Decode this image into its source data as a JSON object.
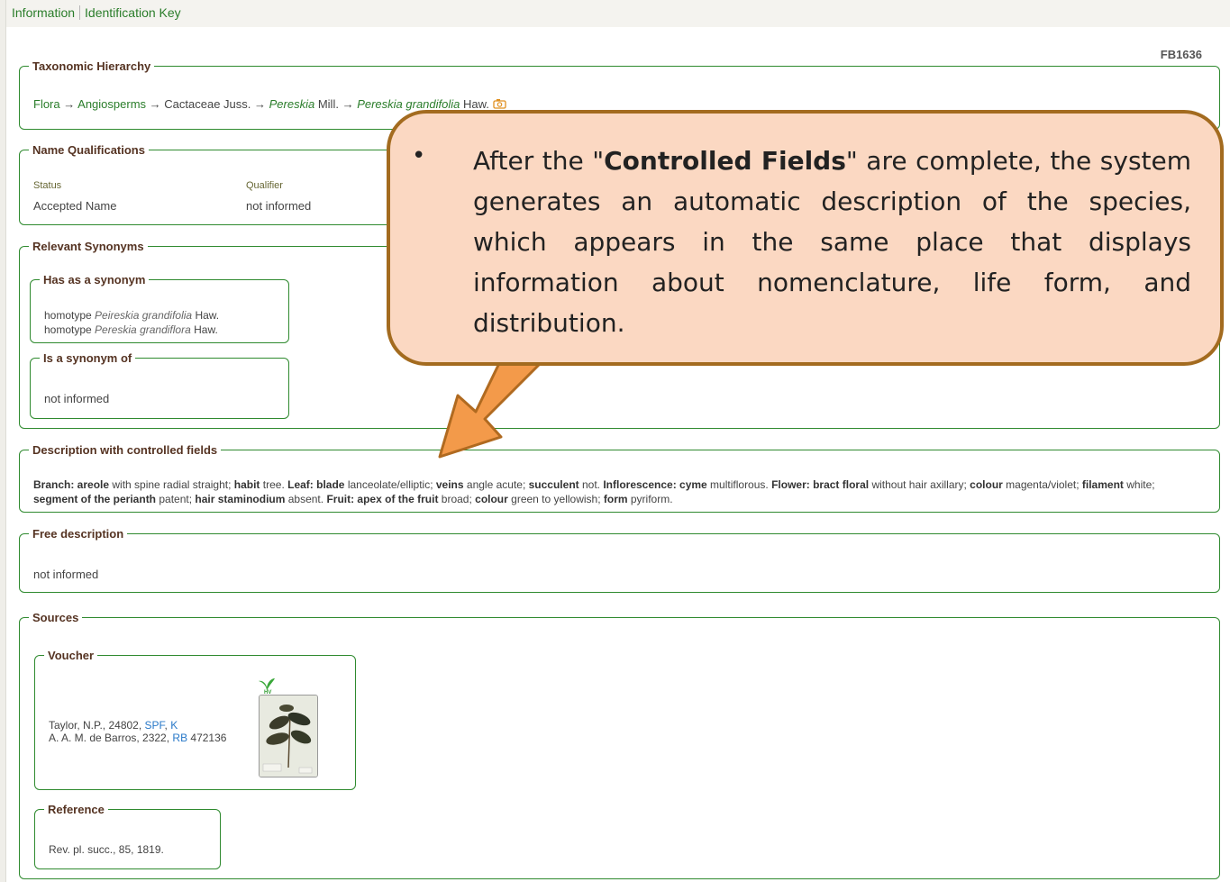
{
  "tabs": [
    "Information",
    "Identification Key"
  ],
  "record_code": "FB1636",
  "taxonomic_hierarchy": {
    "legend": "Taxonomic Hierarchy",
    "flora": "Flora",
    "angiosperms": "Angiosperms",
    "family": "Cactaceae Juss.",
    "genus": "Pereskia",
    "genus_author": "Mill.",
    "species": "Pereskia grandifolia",
    "species_author": "Haw.",
    "arrow": "→",
    "camera_icon": "camera-icon"
  },
  "name_qualifications": {
    "legend": "Name Qualifications",
    "status_label": "Status",
    "status_value": "Accepted Name",
    "qualifier_label": "Qualifier",
    "qualifier_value": "not informed"
  },
  "relevant_synonyms": {
    "legend": "Relevant Synonyms",
    "has_synonym": {
      "legend": "Has as a synonym",
      "items": [
        {
          "type": "homotype",
          "name": "Peireskia grandifolia",
          "author": "Haw."
        },
        {
          "type": "homotype",
          "name": "Pereskia grandiflora",
          "author": "Haw."
        }
      ]
    },
    "is_synonym_of": {
      "legend": "Is a synonym of",
      "value": "not informed"
    }
  },
  "controlled_description": {
    "legend": "Description with controlled fields",
    "parts": [
      {
        "b": "Branch: areole",
        "t": " with spine radial straight; "
      },
      {
        "b": "habit",
        "t": " tree. "
      },
      {
        "b": "Leaf: blade",
        "t": " lanceolate/elliptic; "
      },
      {
        "b": "veins",
        "t": " angle acute; "
      },
      {
        "b": "succulent",
        "t": " not. "
      },
      {
        "b": "Inflorescence: cyme",
        "t": " multiflorous. "
      },
      {
        "b": "Flower: bract floral",
        "t": " without hair axillary; "
      },
      {
        "b": "colour",
        "t": " magenta/violet; "
      },
      {
        "b": "filament",
        "t": " white; "
      },
      {
        "b": "segment of the perianth",
        "t": " patent; "
      },
      {
        "b": "hair staminodium",
        "t": " absent. "
      },
      {
        "b": "Fruit: apex of the fruit",
        "t": " broad; "
      },
      {
        "b": "colour",
        "t": " green to yellowish; "
      },
      {
        "b": "form",
        "t": " pyriform."
      }
    ]
  },
  "free_description": {
    "legend": "Free description",
    "value": "not informed"
  },
  "sources": {
    "legend": "Sources",
    "voucher": {
      "legend": "Voucher",
      "line1_text": "Taylor, N.P., 24802, ",
      "line1_links": [
        "SPF",
        "K"
      ],
      "line2_text": "A. A. M. de Barros, 2322, ",
      "line2_link": "RB",
      "line2_suffix": " 472136",
      "logo_text": "HV"
    },
    "reference": {
      "legend": "Reference",
      "value": "Rev. pl. succ., 85, 1819."
    }
  },
  "callout": {
    "bullet": "•",
    "before": "After the \"",
    "bold": "Controlled Fields",
    "after": "\" are complete, the system generates an automatic description of the species, which appears in the same place that displays information about nomenclature, life form, and distribution."
  }
}
